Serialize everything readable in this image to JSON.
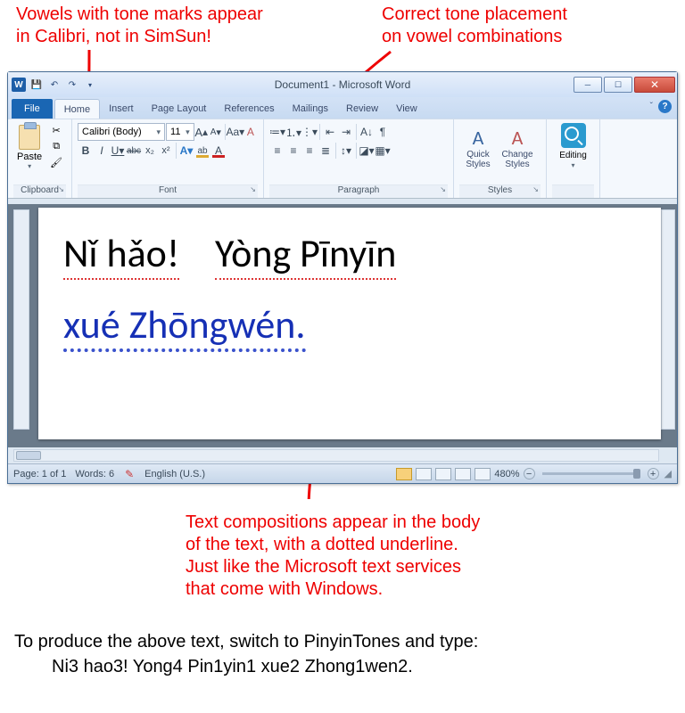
{
  "annotations": {
    "top_left": "Vowels with tone marks appear\nin Calibri, not in SimSun!",
    "top_right": "Correct tone placement\non vowel combinations",
    "bottom_mid": "Text compositions appear in the body\nof the text, with a dotted underline.\nJust like the Microsoft text services\nthat come with Windows."
  },
  "window": {
    "title": "Document1 - Microsoft Word",
    "word_icon_letter": "W"
  },
  "tabs": {
    "file": "File",
    "home": "Home",
    "insert": "Insert",
    "page_layout": "Page Layout",
    "references": "References",
    "mailings": "Mailings",
    "review": "Review",
    "view": "View"
  },
  "ribbon": {
    "clipboard": {
      "label": "Clipboard",
      "paste": "Paste"
    },
    "font": {
      "label": "Font",
      "name": "Calibri (Body)",
      "size": "11",
      "b": "B",
      "i": "I",
      "u": "U",
      "strike": "abc",
      "sub": "x₂",
      "sup": "x²",
      "grow": "A",
      "shrink": "A",
      "case": "Aa",
      "clear": "A",
      "highlight": "ab",
      "color": "A"
    },
    "paragraph": {
      "label": "Paragraph"
    },
    "styles": {
      "label": "Styles",
      "quick": "Quick\nStyles",
      "change": "Change\nStyles"
    },
    "editing": {
      "label": "Editing"
    }
  },
  "document": {
    "line1a": "Nǐ hǎo!",
    "line1b": "Yòng Pīnyīn",
    "line2": "xué Zhōngwén."
  },
  "status": {
    "page": "Page: 1 of 1",
    "words": "Words: 6",
    "language": "English (U.S.)",
    "zoom_value": "480%",
    "zoom_minus": "−",
    "zoom_plus": "+"
  },
  "footer": {
    "line1": "To produce the above text, switch to PinyinTones and type:",
    "line2": "Ni3 hao3!  Yong4 Pin1yin1 xue2 Zhong1wen2."
  }
}
